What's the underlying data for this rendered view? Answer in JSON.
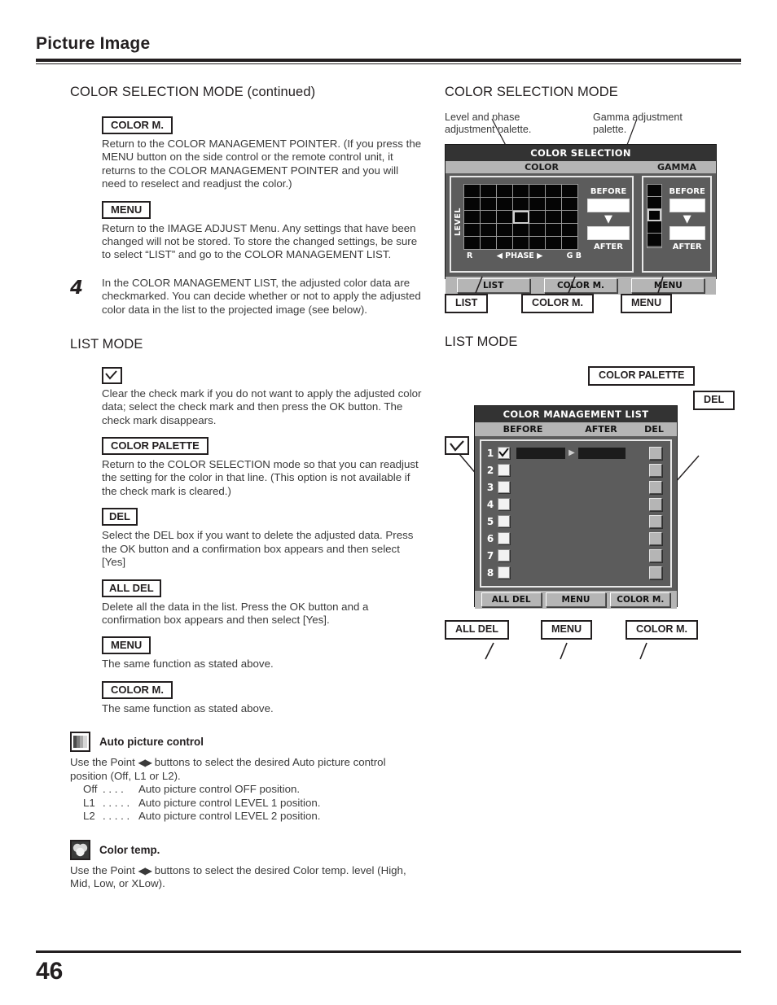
{
  "header": {
    "title": "Picture Image"
  },
  "footer": {
    "page_number": "46"
  },
  "left": {
    "section1_heading": "COLOR SELECTION MODE (continued)",
    "color_m_label": "COLOR M.",
    "color_m_text": "Return to the COLOR MANAGEMENT POINTER. (If you press the MENU button on the side control or the remote control unit, it returns to the COLOR MANAGEMENT POINTER and you will need to reselect and readjust the color.)",
    "menu_label": "MENU",
    "menu_text": "Return to the IMAGE ADJUST Menu. Any settings that have been changed will not be stored. To store the changed settings, be sure to select “LIST” and go to the COLOR MANAGEMENT LIST.",
    "step4_number": "4",
    "step4_text": "In the COLOR MANAGEMENT LIST, the adjusted color data are checkmarked. You can decide whether or not to apply the adjusted color data in the list to the projected image (see below).",
    "list_mode_heading": "LIST MODE",
    "check_icon": "checkmark-icon",
    "check_text": "Clear the check mark if you do not want to apply the adjusted color data; select the check mark and then press the OK button. The check mark disappears.",
    "color_palette_label": "COLOR PALETTE",
    "color_palette_text": "Return to the COLOR SELECTION mode so that you can readjust the setting for the color in that line. (This option is not available if the check mark is cleared.)",
    "del_label": "DEL",
    "del_text": "Select the DEL box if you want to delete the adjusted data. Press the OK button and a confirmation box appears and then select [Yes]",
    "all_del_label": "ALL DEL",
    "all_del_text": "Delete all the data in the list. Press the OK button and a confirmation box appears and then select [Yes].",
    "menu2_label": "MENU",
    "menu2_text": "The same function as stated above.",
    "color_m2_label": "COLOR M.",
    "color_m2_text": "The same function as stated above.",
    "auto_picture": {
      "icon": "auto-picture-control-icon",
      "title": "Auto picture control",
      "text_part1": "Use the Point ",
      "point_glyph": "◀▶",
      "text_part2": " buttons to select the desired Auto picture control position (Off, L1 or L2).",
      "options": [
        {
          "key": "Off",
          "dots": ". . . .",
          "desc": "Auto picture control OFF position."
        },
        {
          "key": "L1",
          "dots": ". . . . .",
          "desc": "Auto picture control LEVEL 1 position."
        },
        {
          "key": "L2",
          "dots": ". . . . .",
          "desc": "Auto picture control LEVEL 2 position."
        }
      ]
    },
    "color_temp": {
      "icon": "color-temp-icon",
      "title": "Color temp.",
      "text_part1": "Use the Point ",
      "point_glyph": "◀▶",
      "text_part2": " buttons to select the desired Color temp. level (High, Mid, Low, or XLow)."
    }
  },
  "right": {
    "cs_heading": "COLOR SELECTION MODE",
    "caption_level_phase": "Level and phase adjustment palette.",
    "caption_gamma": "Gamma adjustment palette.",
    "color_selection_osd": {
      "title": "COLOR SELECTION",
      "color_band": "COLOR",
      "gamma_band": "GAMMA",
      "level_label": "LEVEL",
      "axis_left": "R",
      "axis_center": "◀ PHASE ▶",
      "axis_right": "G B",
      "before_label": "BEFORE",
      "after_label": "AFTER",
      "arrow_glyph": "▼",
      "grid_cols": 7,
      "grid_rows": 5,
      "grid_selected": {
        "row": 2,
        "col": 3
      },
      "gamma_cells": 5,
      "gamma_selected": 2,
      "buttons": [
        "LIST",
        "COLOR M.",
        "MENU"
      ]
    },
    "cs_callouts": [
      {
        "label": "LIST"
      },
      {
        "label": "COLOR M."
      },
      {
        "label": "MENU"
      }
    ],
    "list_heading": "LIST MODE",
    "list_callout_palette": "COLOR PALETTE",
    "list_callout_del": "DEL",
    "list_callout_check": "checkmark-icon",
    "color_list_osd": {
      "title": "COLOR MANAGEMENT LIST",
      "col_before": "BEFORE",
      "col_after": "AFTER",
      "col_del": "DEL",
      "arrow_glyph": "▶",
      "rows": [
        {
          "index": "1",
          "checked": true,
          "has_data": true
        },
        {
          "index": "2",
          "checked": false,
          "has_data": false
        },
        {
          "index": "3",
          "checked": false,
          "has_data": false
        },
        {
          "index": "4",
          "checked": false,
          "has_data": false
        },
        {
          "index": "5",
          "checked": false,
          "has_data": false
        },
        {
          "index": "6",
          "checked": false,
          "has_data": false
        },
        {
          "index": "7",
          "checked": false,
          "has_data": false
        },
        {
          "index": "8",
          "checked": false,
          "has_data": false
        }
      ],
      "buttons": [
        "ALL DEL",
        "MENU",
        "COLOR M."
      ]
    },
    "list_callouts": [
      {
        "label": "ALL DEL"
      },
      {
        "label": "MENU"
      },
      {
        "label": "COLOR M."
      }
    ]
  },
  "colors": {
    "ink": "#231f20",
    "body_text": "#3a3a3a",
    "osd_titlebar": "#333333",
    "osd_band": "#b5b5b5",
    "osd_body": "#5c5c5c",
    "osd_cell": "#050505"
  }
}
